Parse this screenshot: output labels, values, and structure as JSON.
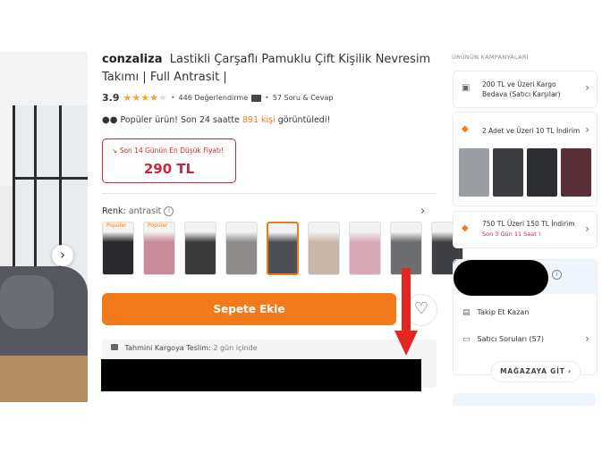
{
  "product": {
    "brand": "conzaliza",
    "title": "Lastikli Çarşaflı Pamuklu Çift Kişilik Nevresim Takımı | Full Antrasit |",
    "rating": "3.9",
    "stars": 4,
    "reviews": "446 Değerlendirme",
    "questions": "57 Soru & Cevap",
    "popular_text": "Popüler ürün! Son 24 saatte",
    "popular_count": "891 kişi",
    "popular_suffix": "görüntüledi!",
    "lowest_price_label": "Son 14 Günün En Düşük Fiyatı!",
    "price": "290 TL",
    "color_label": "Renk:",
    "color_value": "antrasit",
    "add_to_cart": "Sepete Ekle",
    "shipping_label": "Tahmini Kargoya Teslim:",
    "shipping_value": "2 gün içinde"
  },
  "swatches": [
    {
      "tag": "Popüler",
      "color": "#2a2a2e"
    },
    {
      "tag": "Popüler",
      "color": "#c98a9a"
    },
    {
      "tag": "",
      "color": "#3a3a3a"
    },
    {
      "tag": "",
      "color": "#8e8c8a"
    },
    {
      "tag": "",
      "color": "#4e5055"
    },
    {
      "tag": "",
      "color": "#c9b8aa"
    },
    {
      "tag": "",
      "color": "#d8a8b6"
    },
    {
      "tag": "",
      "color": "#6d6e72"
    },
    {
      "tag": "",
      "color": "#3d3f44"
    }
  ],
  "sidebar": {
    "campaigns_title": "ÜRÜNÜN KAMPANYALARI",
    "campaign1": "200 TL ve Üzeri Kargo Bedava (Satıcı Karşılar)",
    "campaign2": "2 Adet ve Üzeri 10 TL İndirim",
    "campaign3": "750 TL Üzeri 150 TL İndirim",
    "campaign3_sub": "Son 3 Gün 11 Saat !",
    "campaign2_thumbs": [
      "#9a9ea3",
      "#3c3d40",
      "#2c2d30",
      "#5a2e36"
    ],
    "follow": "Takip Et Kazan",
    "seller_questions": "Satıcı Soruları (57)",
    "store_button": "MAĞAZAYA GİT"
  },
  "colors": {
    "accent": "#f27a1a",
    "price_red": "#c9273b",
    "arrow_red": "#e52620"
  }
}
